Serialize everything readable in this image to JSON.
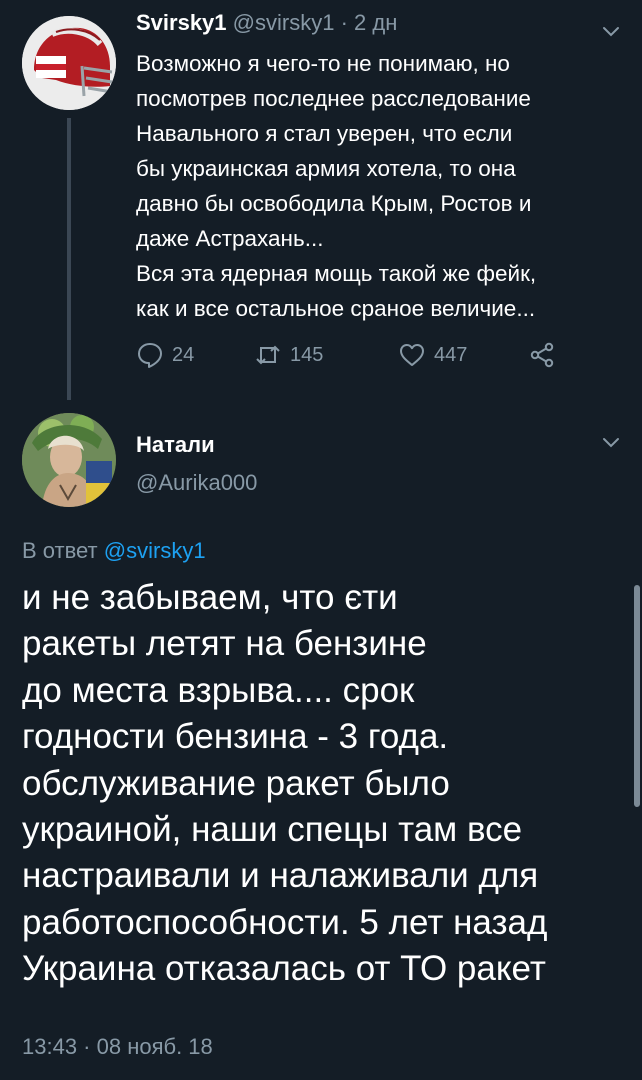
{
  "tweet1": {
    "author_name": "Svirsky1",
    "handle": "@svirsky1",
    "separator": "·",
    "time_ago": "2 дн",
    "text_lines": [
      "Возможно я чего-то не понимаю, но",
      "посмотрев последнее расследование",
      "Навального я стал уверен, что если",
      "бы украинская армия хотела, то она",
      "давно бы освободила Крым, Ростов и",
      "даже Астрахань...",
      "Вся эта ядерная мощь такой же фейк,",
      "как и все остальное сраное величие..."
    ],
    "replies": "24",
    "retweets": "145",
    "likes": "447",
    "icons": [
      "reply-icon",
      "retweet-icon",
      "like-icon",
      "share-icon",
      "chevron-down-icon"
    ]
  },
  "tweet2": {
    "author_name": "Натали",
    "handle": "@Aurika000",
    "reply_prefix": "В ответ",
    "reply_to": "@svirsky1",
    "text_lines": [
      "и не забываем, что єти",
      "ракеты летят на бензине",
      "до места взрыва.... срок",
      "годности бензина - 3 года.",
      "обслуживание ракет было",
      "украиной, наши спецы там все",
      "настраивали и налаживали для",
      "работоспособности. 5 лет назад",
      "Украина отказалась от ТО ракет"
    ],
    "timestamp": "13:43 · 08 нояб. 18"
  },
  "colors": {
    "background": "#141d26",
    "text": "#ffffff",
    "muted": "#8899a6",
    "link": "#1da1f2"
  }
}
